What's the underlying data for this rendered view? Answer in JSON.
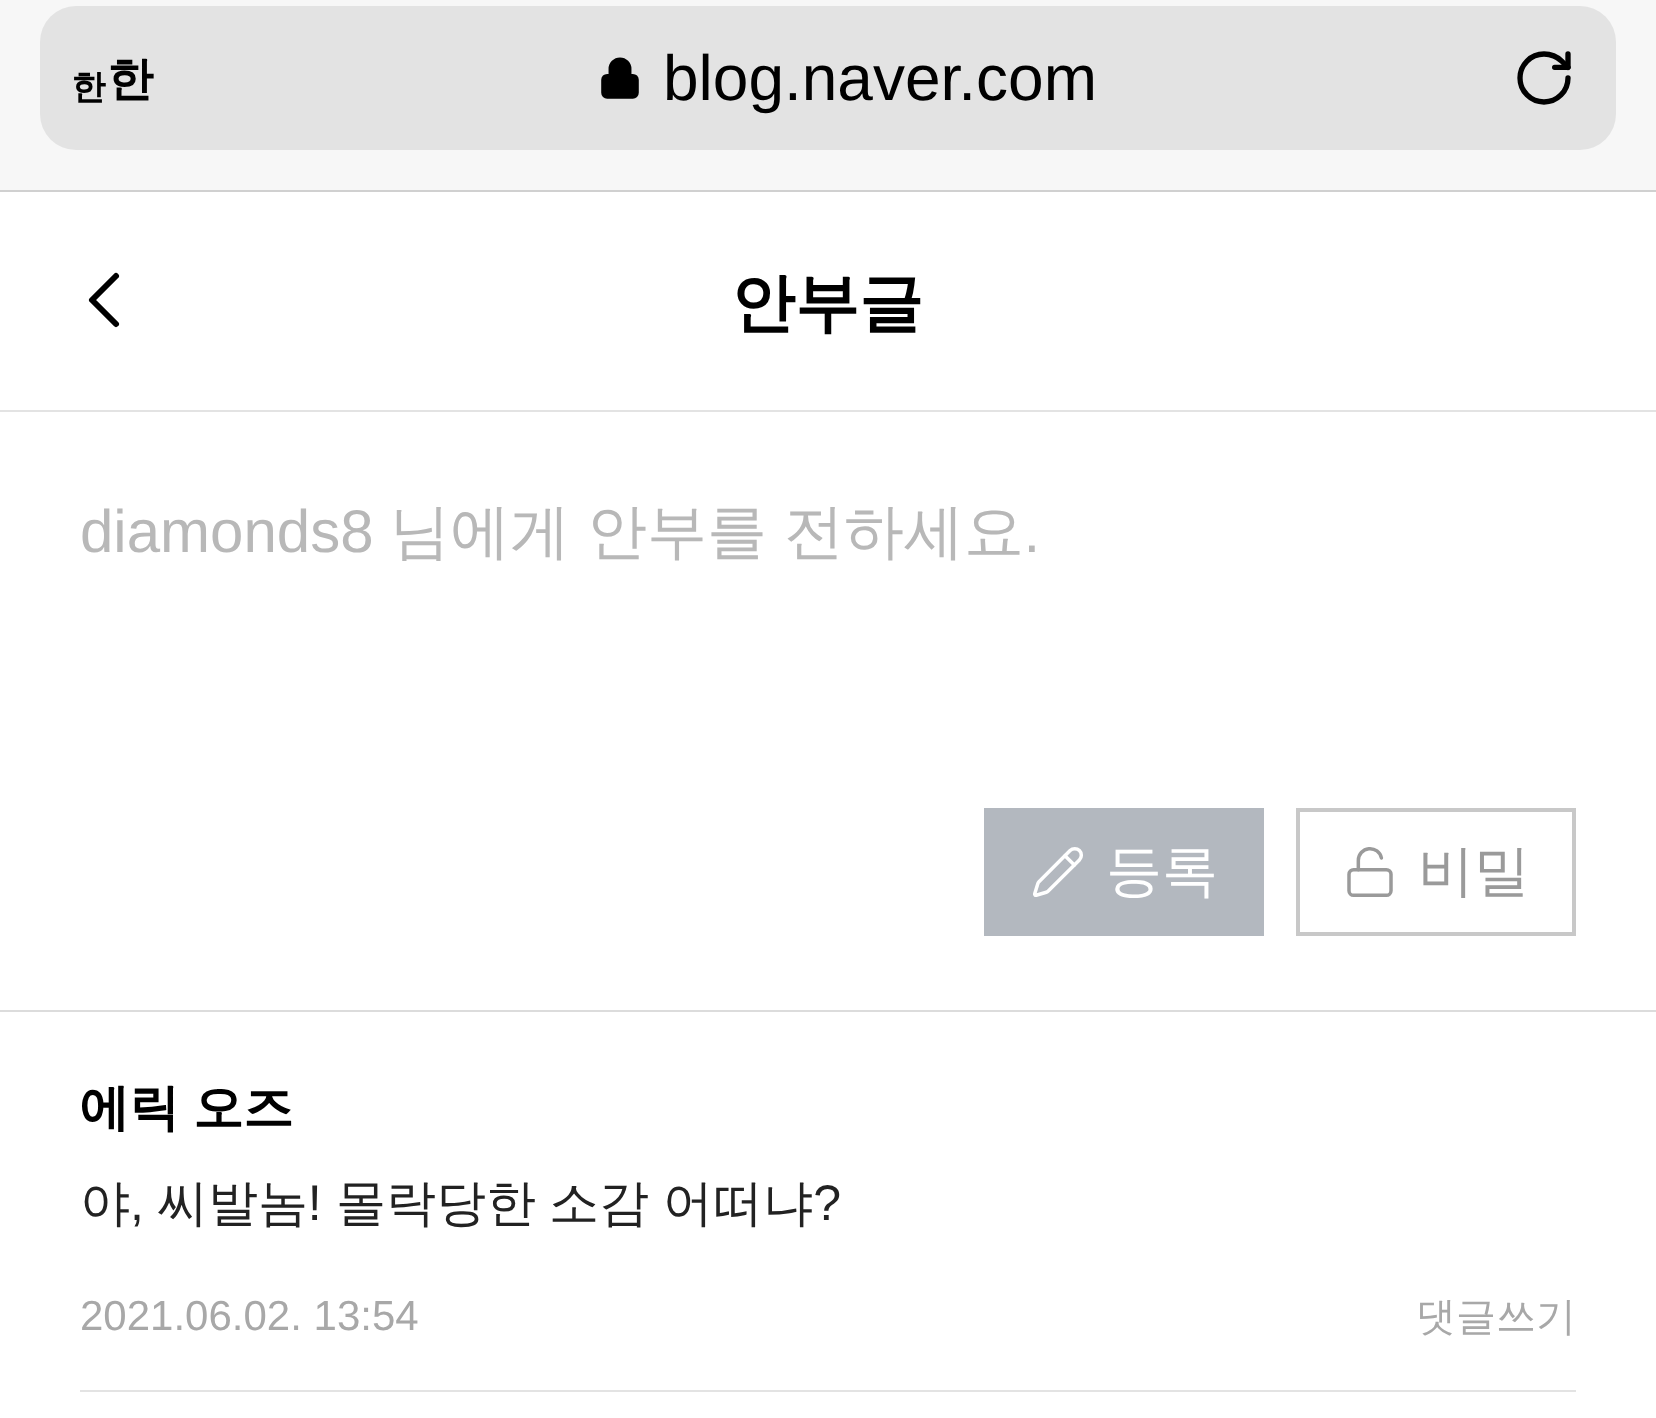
{
  "browser_bar": {
    "text_size_small": "한",
    "text_size_large": "한",
    "url": "blog.naver.com"
  },
  "header": {
    "title": "안부글"
  },
  "editor": {
    "placeholder": "diamonds8 님에게 안부를 전하세요."
  },
  "buttons": [
    {
      "kind": "submit",
      "label": "등록",
      "disabled": true
    },
    {
      "kind": "secret",
      "label": "비밀",
      "disabled": false
    }
  ],
  "comments": [
    {
      "author": "에릭 오즈",
      "text": "야, 씨발놈! 몰락당한 소감 어떠냐?",
      "date": "2021.06.02. 13:54",
      "reply_link": "댓글쓰기"
    }
  ]
}
